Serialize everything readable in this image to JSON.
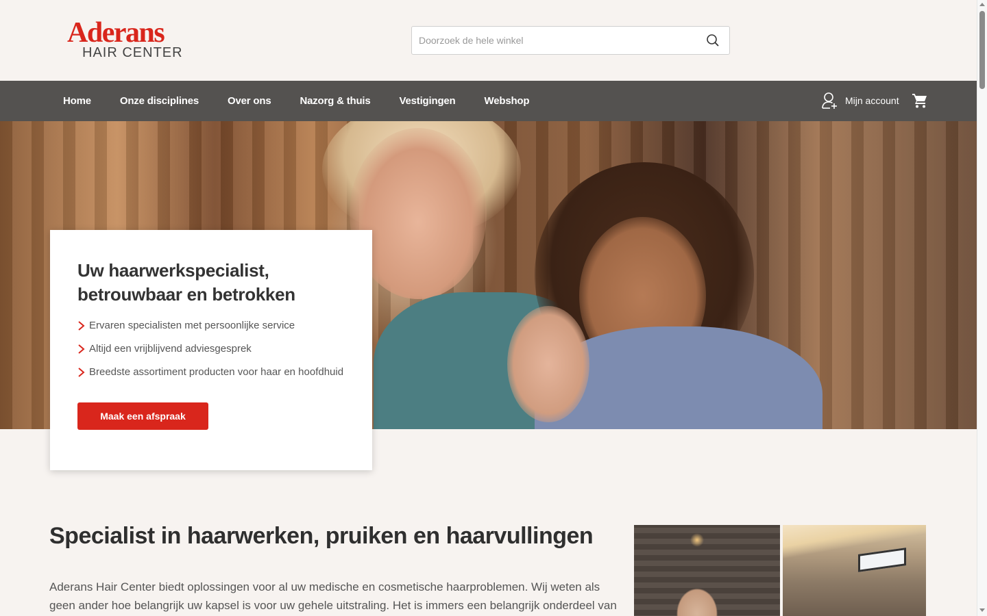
{
  "header": {
    "logo_main": "Aderans",
    "logo_sub": "HAIR CENTER",
    "search_placeholder": "Doorzoek de hele winkel"
  },
  "nav": {
    "items": [
      {
        "label": "Home"
      },
      {
        "label": "Onze disciplines"
      },
      {
        "label": "Over ons"
      },
      {
        "label": "Nazorg & thuis"
      },
      {
        "label": "Vestigingen"
      },
      {
        "label": "Webshop"
      }
    ],
    "account_label": "Mijn account"
  },
  "hero": {
    "title_line1": "Uw haarwerkspecialist,",
    "title_line2": "betrouwbaar en betrokken",
    "bullets": [
      "Ervaren specialisten met persoonlijke service",
      "Altijd een vrijblijvend adviesgesprek",
      "Breedste assortiment producten voor haar en hoofdhuid"
    ],
    "cta_label": "Maak een afspraak"
  },
  "section": {
    "title": "Specialist in haarwerken, pruiken en haarvullingen",
    "text": "Aderans Hair Center biedt oplossingen voor al uw medische en cosmetische haarproblemen. Wij weten als geen ander hoe belangrijk uw kapsel is voor uw gehele uitstraling. Het is immers een belangrijk onderdeel van uw"
  },
  "colors": {
    "brand_red": "#d9261c",
    "nav_bg": "#545250",
    "page_bg": "#f7f3f0"
  }
}
